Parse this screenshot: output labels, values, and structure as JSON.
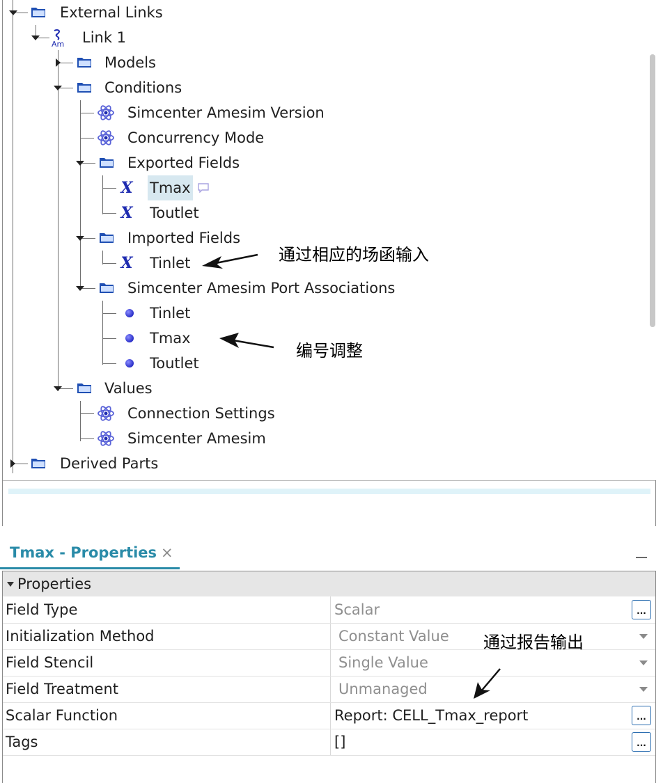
{
  "tree": {
    "items": [
      {
        "label": "External Links",
        "icon": "folder-icon"
      },
      {
        "label": "Link 1",
        "icon": "amesim-link-icon"
      },
      {
        "label": "Models",
        "icon": "folder-icon"
      },
      {
        "label": "Conditions",
        "icon": "folder-icon"
      },
      {
        "label": "Simcenter Amesim Version",
        "icon": "atom-icon"
      },
      {
        "label": "Concurrency Mode",
        "icon": "atom-icon"
      },
      {
        "label": "Exported Fields",
        "icon": "folder-icon"
      },
      {
        "label": "Tmax",
        "icon": "field-x-icon"
      },
      {
        "label": "Toutlet",
        "icon": "field-x-icon"
      },
      {
        "label": "Imported Fields",
        "icon": "folder-icon"
      },
      {
        "label": "Tinlet",
        "icon": "field-x-icon"
      },
      {
        "label": "Simcenter Amesim Port Associations",
        "icon": "folder-icon"
      },
      {
        "label": "Tinlet",
        "icon": "port-dot-icon"
      },
      {
        "label": "Tmax",
        "icon": "port-dot-icon"
      },
      {
        "label": "Toutlet",
        "icon": "port-dot-icon"
      },
      {
        "label": "Values",
        "icon": "folder-icon"
      },
      {
        "label": "Connection Settings",
        "icon": "atom-icon"
      },
      {
        "label": "Simcenter Amesim",
        "icon": "atom-icon"
      },
      {
        "label": "Derived Parts",
        "icon": "folder-icon"
      }
    ]
  },
  "annotations": {
    "imported": "通过相应的场函输入",
    "ports": "编号调整",
    "report": "通过报告输出"
  },
  "properties_panel": {
    "tab_title": "Tmax - Properties",
    "close_glyph": "×",
    "section": "Properties",
    "rows": [
      {
        "name": "Field Type",
        "value": "Scalar"
      },
      {
        "name": "Initialization Method",
        "value": "Constant Value"
      },
      {
        "name": "Field Stencil",
        "value": "Single Value"
      },
      {
        "name": "Field Treatment",
        "value": "Unmanaged"
      },
      {
        "name": "Scalar Function",
        "value": "Report: CELL_Tmax_report"
      },
      {
        "name": "Tags",
        "value": "[]"
      }
    ],
    "ellipsis_label": "..."
  },
  "colors": {
    "accent": "#2a8ba8",
    "selection": "#d7e8f0",
    "field_icon": "#1e2bb0"
  }
}
